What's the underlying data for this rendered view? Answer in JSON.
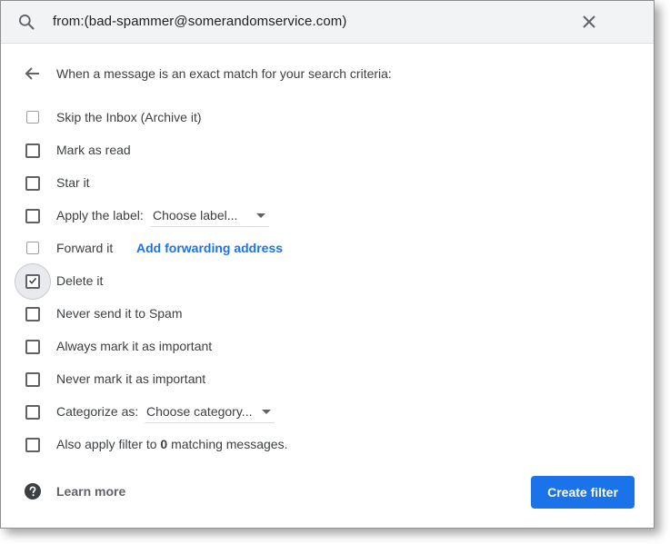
{
  "search": {
    "query": "from:(bad-spammer@somerandomservice.com)"
  },
  "header": {
    "text": "When a message is an exact match for your search criteria:"
  },
  "options": {
    "skip_inbox": {
      "label": "Skip the Inbox (Archive it)",
      "checked": false
    },
    "mark_read": {
      "label": "Mark as read",
      "checked": false
    },
    "star": {
      "label": "Star it",
      "checked": false
    },
    "apply_label": {
      "label": "Apply the label:",
      "checked": false,
      "dropdown": "Choose label..."
    },
    "forward": {
      "label": "Forward it",
      "checked": false,
      "link": "Add forwarding address"
    },
    "delete": {
      "label": "Delete it",
      "checked": true
    },
    "never_spam": {
      "label": "Never send it to Spam",
      "checked": false
    },
    "always_important": {
      "label": "Always mark it as important",
      "checked": false
    },
    "never_important": {
      "label": "Never mark it as important",
      "checked": false
    },
    "categorize": {
      "label": "Categorize as:",
      "checked": false,
      "dropdown": "Choose category..."
    },
    "also_apply": {
      "label_prefix": "Also apply filter to",
      "count": "0",
      "label_suffix": "matching messages.",
      "checked": false
    }
  },
  "footer": {
    "learn_more": "Learn more",
    "create_filter": "Create filter"
  },
  "colors": {
    "accent": "#1a73e8",
    "search_bg": "#f1f3f4"
  },
  "icons": {
    "search": "search-icon",
    "close": "close-icon",
    "back": "arrow-back-icon",
    "help": "help-icon",
    "check": "check-icon",
    "dropdown": "caret-down-icon"
  }
}
